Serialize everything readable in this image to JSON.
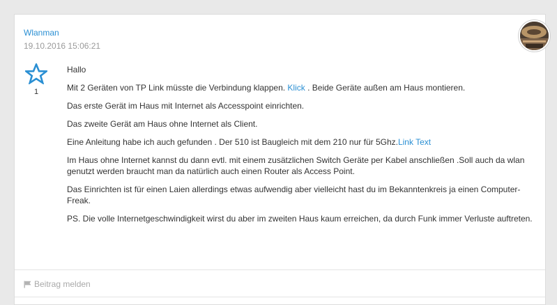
{
  "post": {
    "author": "Wlanman",
    "timestamp": "19.10.2016 15:06:21",
    "vote_count": "1",
    "paragraphs": {
      "p1": "Hallo",
      "p2_before": "Mit 2 Geräten von TP Link müsste die Verbindung klappen. ",
      "p2_link": "Klick",
      "p2_after": " . Beide Geräte außen am Haus montieren.",
      "p3": "Das erste Gerät im Haus mit Internet als Accesspoint einrichten.",
      "p4": "Das zweite Gerät am Haus ohne Internet als Client.",
      "p5_before": "Eine Anleitung habe ich auch gefunden . Der 510 ist Baugleich mit dem 210 nur für 5Ghz.",
      "p5_link": "Link Text",
      "p6": "Im Haus ohne Internet kannst du dann evtl. mit einem zusätzlichen Switch Geräte per Kabel anschließen .Soll auch da wlan genutzt werden braucht man da natürlich auch einen Router als Access Point.",
      "p7": "Das Einrichten ist für einen Laien allerdings etwas aufwendig aber vielleicht hast du im Bekanntenkreis ja einen Computer-Freak.",
      "p8": "PS. Die volle Internetgeschwindigkeit wirst du aber im zweiten Haus kaum erreichen, da durch Funk immer Verluste auftreten."
    },
    "report_label": "Beitrag melden"
  },
  "colors": {
    "link": "#2a8fd3",
    "text": "#333333",
    "muted": "#9a9a9a",
    "background": "#e9e9e9"
  },
  "icons": {
    "vote": "star-icon",
    "report": "flag-icon",
    "avatar": "avatar"
  }
}
